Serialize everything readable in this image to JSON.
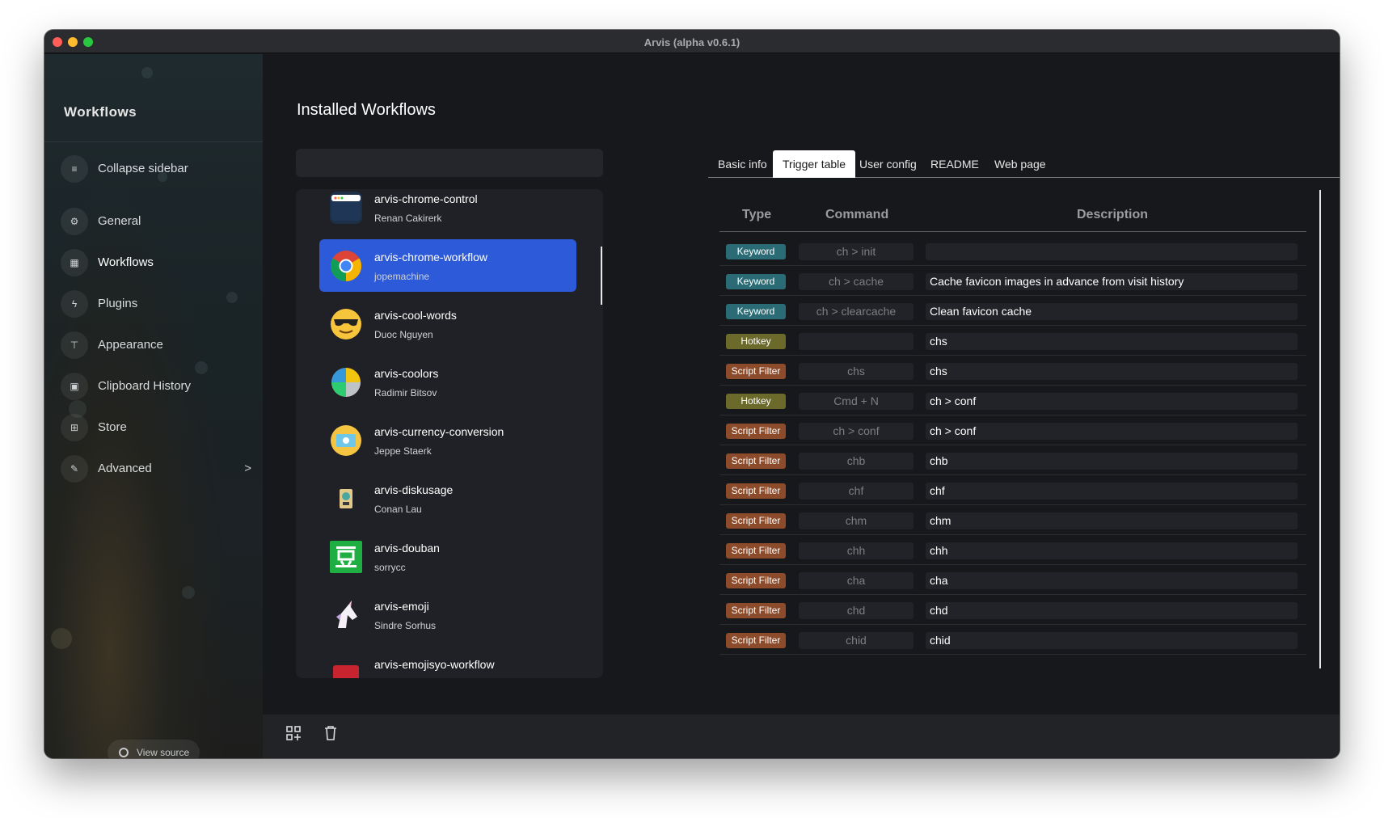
{
  "window": {
    "title": "Arvis (alpha v0.6.1)"
  },
  "sidebar": {
    "title": "Workflows",
    "items": [
      {
        "label": "Collapse sidebar",
        "icon": "collapse-icon"
      },
      {
        "label": "General",
        "icon": "gear-icon"
      },
      {
        "label": "Workflows",
        "icon": "grid-icon",
        "active": true
      },
      {
        "label": "Plugins",
        "icon": "bolt-icon"
      },
      {
        "label": "Appearance",
        "icon": "paint-roller-icon"
      },
      {
        "label": "Clipboard History",
        "icon": "clipboard-icon"
      },
      {
        "label": "Store",
        "icon": "store-icon"
      },
      {
        "label": "Advanced",
        "icon": "wrench-icon",
        "chevron": ">"
      }
    ],
    "view_source": "View source"
  },
  "main": {
    "title": "Installed Workflows",
    "search": {
      "placeholder": "",
      "value": ""
    },
    "workflows": [
      {
        "name": "arvis-chrome-control",
        "author": "Renan Cakirerk",
        "icon": "browser-window-icon"
      },
      {
        "name": "arvis-chrome-workflow",
        "author": "jopemachine",
        "icon": "chrome-icon",
        "selected": true
      },
      {
        "name": "arvis-cool-words",
        "author": "Duoc Nguyen",
        "icon": "sunglasses-emoji-icon"
      },
      {
        "name": "arvis-coolors",
        "author": "Radimir Bitsov",
        "icon": "color-wheel-icon"
      },
      {
        "name": "arvis-currency-conversion",
        "author": "Jeppe Staerk",
        "icon": "currency-icon"
      },
      {
        "name": "arvis-diskusage",
        "author": "Conan Lau",
        "icon": "disk-badge-icon"
      },
      {
        "name": "arvis-douban",
        "author": "sorrycc",
        "icon": "douban-icon"
      },
      {
        "name": "arvis-emoji",
        "author": "Sindre Sorhus",
        "icon": "unicorn-icon"
      },
      {
        "name": "arvis-emojisyo-workflow",
        "author": "",
        "icon": "book-icon"
      }
    ],
    "tabs": [
      {
        "label": "Basic info"
      },
      {
        "label": "Trigger table",
        "active": true
      },
      {
        "label": "User config"
      },
      {
        "label": "README"
      },
      {
        "label": "Web page"
      }
    ],
    "table": {
      "headers": [
        "Type",
        "Command",
        "Description"
      ],
      "rows": [
        {
          "type": "Keyword",
          "command": "ch > init",
          "description": ""
        },
        {
          "type": "Keyword",
          "command": "ch > cache",
          "description": "Cache favicon images in advance from visit history"
        },
        {
          "type": "Keyword",
          "command": "ch > clearcache",
          "description": "Clean favicon cache"
        },
        {
          "type": "Hotkey",
          "command": "",
          "description": "chs"
        },
        {
          "type": "Script Filter",
          "command": "chs",
          "description": "chs"
        },
        {
          "type": "Hotkey",
          "command": "Cmd + N",
          "description": "ch > conf"
        },
        {
          "type": "Script Filter",
          "command": "ch > conf",
          "description": "ch > conf"
        },
        {
          "type": "Script Filter",
          "command": "chb",
          "description": "chb"
        },
        {
          "type": "Script Filter",
          "command": "chf",
          "description": "chf"
        },
        {
          "type": "Script Filter",
          "command": "chm",
          "description": "chm"
        },
        {
          "type": "Script Filter",
          "command": "chh",
          "description": "chh"
        },
        {
          "type": "Script Filter",
          "command": "cha",
          "description": "cha"
        },
        {
          "type": "Script Filter",
          "command": "chd",
          "description": "chd"
        },
        {
          "type": "Script Filter",
          "command": "chid",
          "description": "chid"
        }
      ]
    },
    "toolbar": [
      {
        "icon": "add-workflow-icon"
      },
      {
        "icon": "trash-icon"
      }
    ]
  },
  "colors": {
    "accent": "#2d5ad8",
    "keyword": "#2b6b75",
    "hotkey": "#6c6a2b",
    "script_filter": "#8c4b2a"
  }
}
